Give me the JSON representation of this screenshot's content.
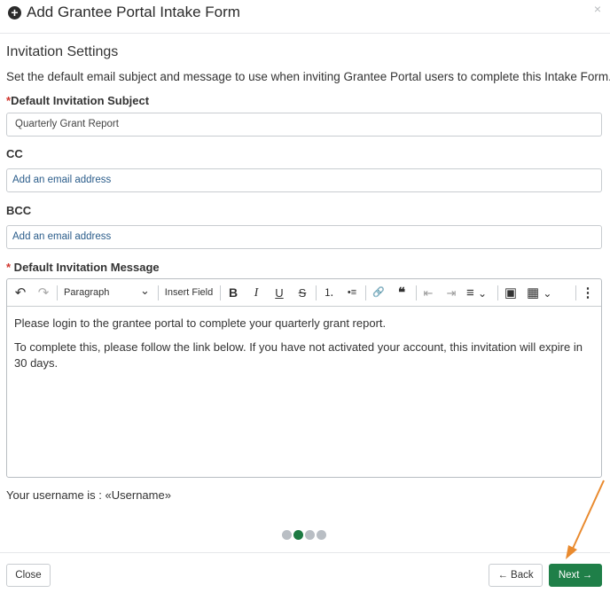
{
  "header": {
    "title": "Add Grantee Portal Intake Form",
    "plus_icon": "+",
    "close_icon": "×"
  },
  "section": {
    "title": "Invitation Settings",
    "description": "Set the default email subject and message to use when inviting Grantee Portal users to complete this Intake Form."
  },
  "subject": {
    "required_mark": "*",
    "label": "Default Invitation Subject",
    "value": "Quarterly Grant Report"
  },
  "cc": {
    "label": "CC",
    "placeholder": "Add an email address"
  },
  "bcc": {
    "label": "BCC",
    "placeholder": "Add an email address"
  },
  "message": {
    "required_mark": "*",
    "label": " Default Invitation Message",
    "toolbar": {
      "undo": "↶",
      "redo": "↷",
      "paragraph": "Paragraph",
      "chevron": "⌄",
      "insert_field": "Insert Field",
      "bold": "B",
      "italic": "I",
      "underline": "U",
      "strike": "S",
      "ordered_list": "⒈",
      "bullet_list": "•≡",
      "link": "🔗",
      "quote": "❝",
      "outdent": "⇤",
      "indent": "⇥",
      "align": "≡",
      "image": "▣",
      "table": "▦",
      "more": "⋮"
    },
    "paragraphs": [
      "Please login to the grantee portal to complete your quarterly grant report.",
      "To complete this, please follow the link below. If you have not activated your account, this invitation will expire in 30 days."
    ]
  },
  "username_line": "Your username is : «Username»",
  "stepper": {
    "total_steps": 4,
    "current_step": 2
  },
  "footer": {
    "close": "Close",
    "back": "← Back",
    "next": "Next →"
  },
  "colors": {
    "primary": "#1f7f48",
    "annotation_arrow": "#e98a2e",
    "required": "#d0342c"
  }
}
